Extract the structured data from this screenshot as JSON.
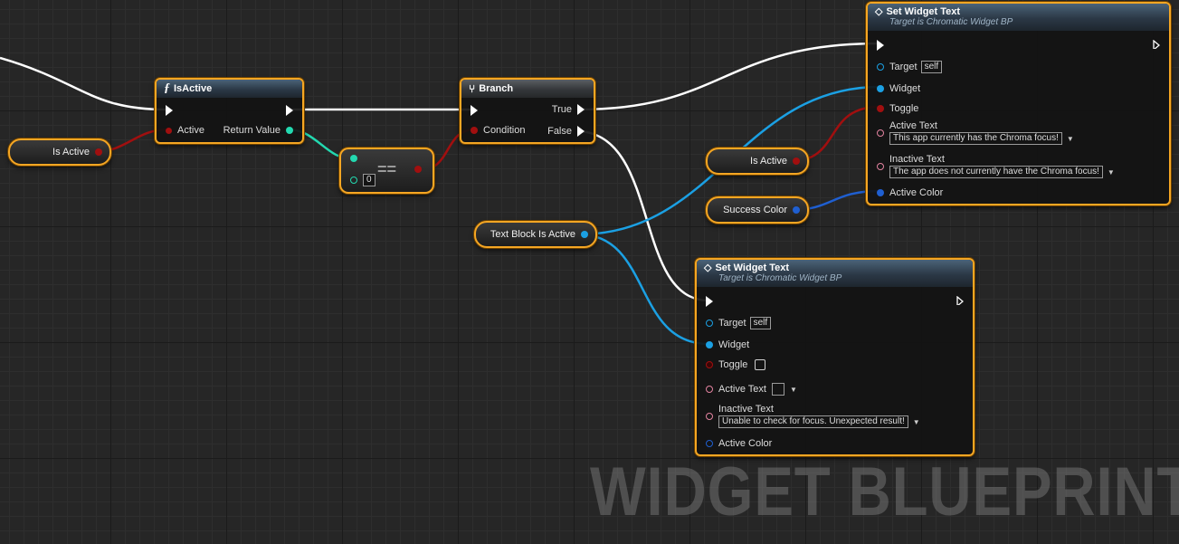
{
  "colors": {
    "exec": "#ffffff",
    "bool": "#a10f0f",
    "object": "#1ba0e3",
    "integer": "#23d9b0",
    "text": "#e383a0",
    "struct": "#1f5fd1",
    "node_border": "#f5a623"
  },
  "nodes": {
    "is_active_getter": {
      "label": "Is Active"
    },
    "isactive_func": {
      "icon": "function-icon",
      "title": "IsActive",
      "pin_active": "Active",
      "pin_return": "Return Value"
    },
    "equal_node": {
      "symbol": "==",
      "int_value": "0"
    },
    "branch": {
      "title": "Branch",
      "pin_true": "True",
      "pin_condition": "Condition",
      "pin_false": "False"
    },
    "is_active_getter_2": {
      "label": "Is Active"
    },
    "success_color": {
      "label": "Success Color"
    },
    "text_block": {
      "label": "Text Block Is Active"
    },
    "set_widget_text_1": {
      "title": "Set Widget Text",
      "subtitle": "Target is Chromatic Widget BP",
      "pin_target": "Target",
      "target_value": "self",
      "pin_widget": "Widget",
      "pin_toggle": "Toggle",
      "pin_active_text": "Active Text",
      "active_text_value": "This app currently has the Chroma focus!",
      "pin_inactive_text": "Inactive Text",
      "inactive_text_value": "The app does not currently have the Chroma focus!",
      "pin_active_color": "Active Color"
    },
    "set_widget_text_2": {
      "title": "Set Widget Text",
      "subtitle": "Target is Chromatic Widget BP",
      "pin_target": "Target",
      "target_value": "self",
      "pin_widget": "Widget",
      "pin_toggle": "Toggle",
      "pin_active_text": "Active Text",
      "active_text_value": "",
      "pin_inactive_text": "Inactive Text",
      "inactive_text_value": "Unable to check for focus. Unexpected result!",
      "pin_active_color": "Active Color"
    }
  },
  "watermark": "WIDGET BLUEPRINT"
}
